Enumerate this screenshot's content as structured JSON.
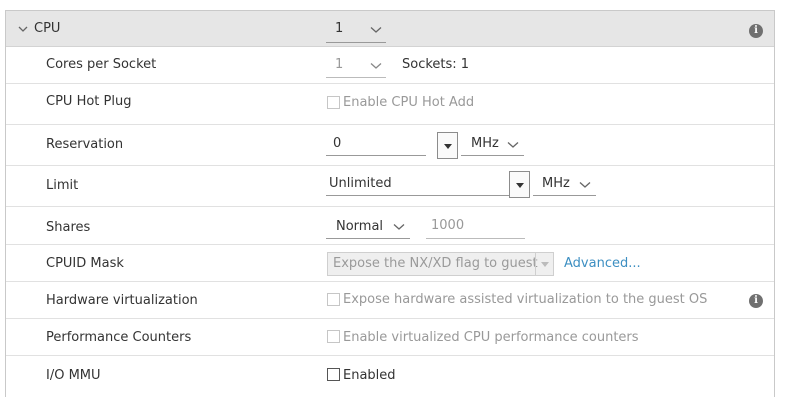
{
  "header": {
    "title": "CPU",
    "cpu_count": "1"
  },
  "rows": {
    "cores_per_socket": {
      "label": "Cores per Socket",
      "value": "1",
      "sockets": "Sockets: 1"
    },
    "cpu_hot_plug": {
      "label": "CPU Hot Plug",
      "checkbox_label": "Enable CPU Hot Add",
      "checked": false
    },
    "reservation": {
      "label": "Reservation",
      "value": "0",
      "unit": "MHz"
    },
    "limit": {
      "label": "Limit",
      "value": "Unlimited",
      "unit": "MHz"
    },
    "shares": {
      "label": "Shares",
      "level": "Normal",
      "value": "1000"
    },
    "cpuid_mask": {
      "label": "CPUID Mask",
      "value": "Expose the NX/XD flag to guest",
      "link": "Advanced..."
    },
    "hardware_virtualization": {
      "label": "Hardware virtualization",
      "checkbox_label": "Expose hardware assisted virtualization to the guest OS",
      "checked": false
    },
    "performance_counters": {
      "label": "Performance Counters",
      "checkbox_label": "Enable virtualized CPU performance counters",
      "checked": false
    },
    "io_mmu": {
      "label": "I/O MMU",
      "checkbox_label": "Enabled",
      "checked": false
    }
  },
  "icons": {
    "info": "info-icon",
    "chevron": "chevron-down-icon",
    "collapse": "chevron-down-icon"
  }
}
